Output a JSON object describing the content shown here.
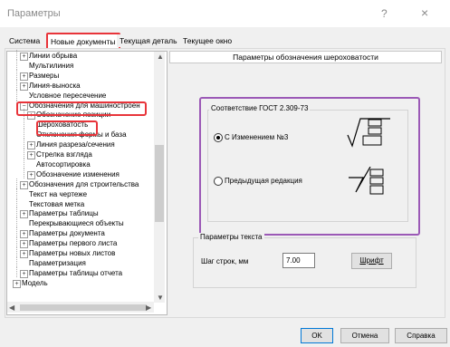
{
  "window": {
    "title": "Параметры",
    "help_label": "?",
    "close_label": "×"
  },
  "tabs": [
    {
      "label": "Система",
      "active": false
    },
    {
      "label": "Новые документы",
      "active": true
    },
    {
      "label": "Текущая деталь",
      "active": false
    },
    {
      "label": "Текущее окно",
      "active": false
    }
  ],
  "tree": {
    "items": [
      {
        "label": "Линии обрыва",
        "expander": "+"
      },
      {
        "label": "Мультилиния",
        "expander": ""
      },
      {
        "label": "Размеры",
        "expander": "+"
      },
      {
        "label": "Линия-выноска",
        "expander": "+"
      },
      {
        "label": "Условное пересечение",
        "expander": ""
      },
      {
        "label": "Обозначения для машиностроен",
        "expander": "−"
      },
      {
        "label": "Обозначение позиции",
        "expander": "+"
      },
      {
        "label": "Шероховатость",
        "expander": ""
      },
      {
        "label": "Отклонения формы и база",
        "expander": ""
      },
      {
        "label": "Линия разреза/сечения",
        "expander": "+"
      },
      {
        "label": "Стрелка взгляда",
        "expander": "+"
      },
      {
        "label": "Автосортировка",
        "expander": ""
      },
      {
        "label": "Обозначение изменения",
        "expander": "+"
      },
      {
        "label": "Обозначения для строительства",
        "expander": "+"
      },
      {
        "label": "Текст на чертеже",
        "expander": ""
      },
      {
        "label": "Текстовая метка",
        "expander": ""
      },
      {
        "label": "Параметры таблицы",
        "expander": "+"
      },
      {
        "label": "Перекрывающиеся объекты",
        "expander": ""
      },
      {
        "label": "Параметры документа",
        "expander": "+"
      },
      {
        "label": "Параметры первого листа",
        "expander": "+"
      },
      {
        "label": "Параметры новых листов",
        "expander": "+"
      },
      {
        "label": "Параметризация",
        "expander": ""
      },
      {
        "label": "Параметры таблицы отчета",
        "expander": "+"
      },
      {
        "label": "Модель",
        "expander": "+"
      }
    ],
    "scroll_up": "▲",
    "scroll_down": "▼",
    "scroll_left": "◀",
    "scroll_right": "▶"
  },
  "panel": {
    "header": "Параметры обозначения шероховатости",
    "gost_group": {
      "title": "Соответствие ГОСТ 2.309-73",
      "option_new": "С Изменением №3",
      "option_old": "Предыдущая редакция",
      "selected": "option_new"
    },
    "text_group": {
      "title": "Параметры текста",
      "line_spacing_label": "Шаг строк, мм",
      "line_spacing_value": "7.00",
      "font_button": "Шрифт"
    }
  },
  "footer": {
    "ok": "OK",
    "cancel": "Отмена",
    "help": "Справка"
  },
  "colors": {
    "highlight_red": "#e8343a",
    "highlight_purple": "#9b59b6"
  }
}
